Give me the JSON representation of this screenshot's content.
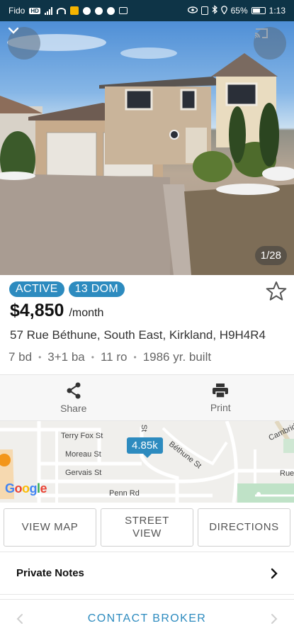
{
  "status_bar": {
    "carrier": "Fido",
    "battery": "65%",
    "time": "1:13"
  },
  "gallery": {
    "counter": "1/28",
    "collapse_icon": "chevron-down-icon",
    "cast_icon": "cast-icon"
  },
  "listing": {
    "status_badge": "ACTIVE",
    "dom_badge": "13 DOM",
    "price": "$4,850",
    "price_unit": "/month",
    "address": "57 Rue Béthune, South East, Kirkland, H9H4R4",
    "facts": [
      "7 bd",
      "3+1 ba",
      "11 ro",
      "1986 yr. built"
    ]
  },
  "actions": {
    "share_label": "Share",
    "print_label": "Print"
  },
  "map": {
    "distance_pin": "4.85k",
    "streets": [
      "Terry Fox St",
      "Moreau St",
      "Gervais St",
      "Penn Rd",
      "Béthune St",
      "St",
      "Cambrid",
      "Rue"
    ],
    "attribution": "Google"
  },
  "map_buttons": {
    "view_map": "VIEW MAP",
    "street_view": "STREET VIEW",
    "directions": "DIRECTIONS"
  },
  "notes": {
    "label": "Private Notes"
  },
  "bottom": {
    "contact": "CONTACT BROKER"
  },
  "colors": {
    "accent": "#2d8bbf",
    "status_bar": "#0e3447"
  }
}
